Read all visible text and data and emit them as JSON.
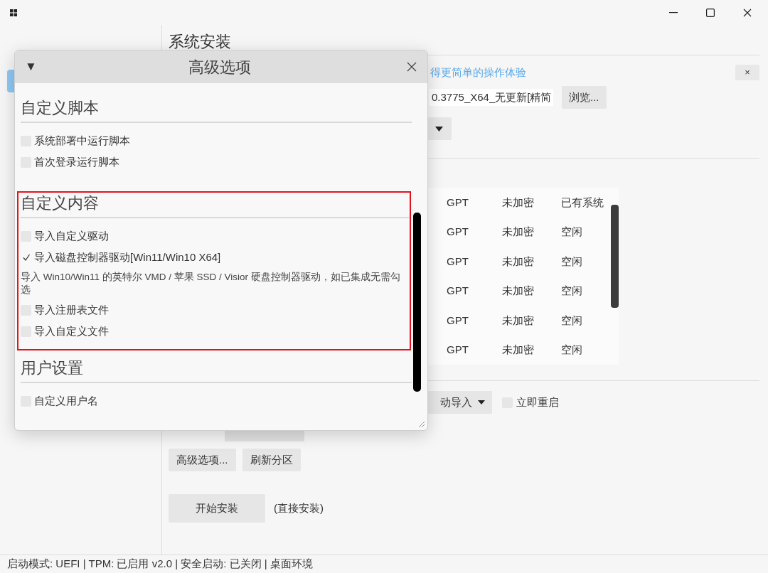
{
  "window": {
    "controls": [
      {
        "kind": "minimize"
      },
      {
        "kind": "maximize"
      },
      {
        "kind": "close"
      }
    ]
  },
  "sidebar": {
    "items": [
      {
        "selected": true
      }
    ]
  },
  "page": {
    "title": "系统安装",
    "banner": {
      "link": "得更简单的操作体验",
      "close": "×"
    },
    "image_path": {
      "value": "0.3775_X64_无更新[精简",
      "browse": "浏览..."
    },
    "partitions": {
      "rows": [
        [
          "GPT",
          "未加密",
          "已有系统"
        ],
        [
          "GPT",
          "未加密",
          "空闲"
        ],
        [
          "GPT",
          "未加密",
          "空闲"
        ],
        [
          "GPT",
          "未加密",
          "空闲"
        ],
        [
          "GPT",
          "未加密",
          "空闲"
        ],
        [
          "GPT",
          "未加密",
          "空闲"
        ]
      ]
    },
    "driver_dropdown": "动导入",
    "restart_now": {
      "label": "立即重启",
      "checked": false
    },
    "buttons": [
      "高级选项...",
      "刷新分区"
    ],
    "start": {
      "label": "开始安装",
      "note": "(直接安装)"
    }
  },
  "dialog": {
    "title": "高级选项",
    "collapse": "▼",
    "sections": [
      {
        "title": "自定义脚本",
        "highlighted": false,
        "items": [
          {
            "kind": "checkbox",
            "label": "系统部署中运行脚本",
            "checked": false
          },
          {
            "kind": "checkbox",
            "label": "首次登录运行脚本",
            "checked": false
          }
        ]
      },
      {
        "title": "自定义内容",
        "highlighted": true,
        "items": [
          {
            "kind": "checkbox",
            "label": "导入自定义驱动",
            "checked": false
          },
          {
            "kind": "checkbox",
            "label": "导入磁盘控制器驱动[Win11/Win10 X64]",
            "checked": true
          },
          {
            "kind": "note",
            "label": "导入 Win10/Win11 的英特尔 VMD / 苹果 SSD / Visior 硬盘控制器驱动，如已集成无需勾选"
          },
          {
            "kind": "checkbox",
            "label": "导入注册表文件",
            "checked": false
          },
          {
            "kind": "checkbox",
            "label": "导入自定义文件",
            "checked": false
          }
        ]
      },
      {
        "title": "用户设置",
        "highlighted": false,
        "items": [
          {
            "kind": "checkbox",
            "label": "自定义用户名",
            "checked": false
          }
        ]
      }
    ]
  },
  "status_bar": "启动模式: UEFI | TPM: 已启用 v2.0 | 安全启动: 已关闭 | 桌面环境"
}
